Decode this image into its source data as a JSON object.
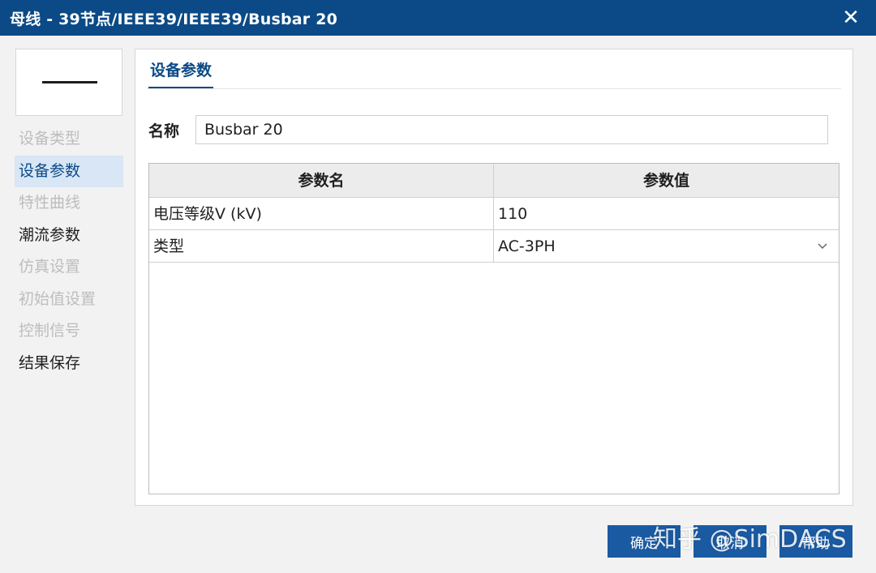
{
  "window": {
    "title": "母线 - 39节点/IEEE39/IEEE39/Busbar 20",
    "close_icon": "close-icon"
  },
  "sidebar": {
    "items": [
      {
        "label": "设备类型",
        "state": "disabled"
      },
      {
        "label": "设备参数",
        "state": "active"
      },
      {
        "label": "特性曲线",
        "state": "disabled"
      },
      {
        "label": "潮流参数",
        "state": "normal"
      },
      {
        "label": "仿真设置",
        "state": "disabled"
      },
      {
        "label": "初始值设置",
        "state": "disabled"
      },
      {
        "label": "控制信号",
        "state": "disabled"
      },
      {
        "label": "结果保存",
        "state": "normal"
      }
    ]
  },
  "main": {
    "tab_label": "设备参数",
    "name_label": "名称",
    "name_value": "Busbar 20",
    "table": {
      "columns": [
        "参数名",
        "参数值"
      ],
      "rows": [
        {
          "name": "电压等级V (kV)",
          "value": "110"
        },
        {
          "name": "类型",
          "value": "AC-3PH",
          "dropdown": true
        }
      ]
    }
  },
  "buttons": {
    "ok": "确定",
    "cancel": "取消",
    "help": "帮助"
  },
  "watermark": "知乎 @SimDACS",
  "colors": {
    "titlebar": "#0b4a86",
    "accent": "#0b4a86",
    "button": "#1a5aa3",
    "active_nav_bg": "#d8e6f5"
  }
}
